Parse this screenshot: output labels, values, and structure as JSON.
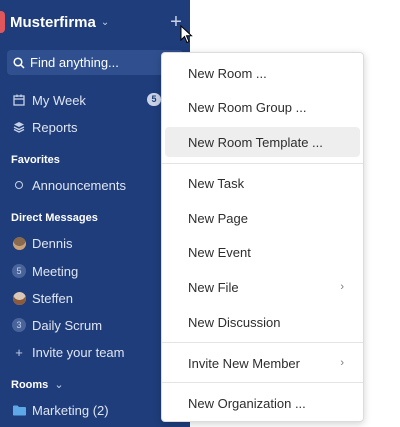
{
  "workspace": {
    "name": "Musterfirma"
  },
  "search": {
    "placeholder": "Find anything..."
  },
  "nav": {
    "my_week": {
      "label": "My Week",
      "badge": "5"
    },
    "reports": {
      "label": "Reports"
    }
  },
  "favorites": {
    "title": "Favorites",
    "items": [
      {
        "label": "Announcements"
      }
    ]
  },
  "direct_messages": {
    "title": "Direct Messages",
    "items": [
      {
        "label": "Dennis",
        "avatar": ""
      },
      {
        "label": "Meeting",
        "avatar": "5"
      },
      {
        "label": "Steffen",
        "avatar": ""
      },
      {
        "label": "Daily Scrum",
        "avatar": "3"
      }
    ],
    "invite_label": "Invite your team"
  },
  "rooms": {
    "title": "Rooms",
    "items": [
      {
        "label": "Marketing (2)"
      }
    ]
  },
  "menu": {
    "items": [
      {
        "label": "New Room ..."
      },
      {
        "label": "New Room Group ..."
      },
      {
        "label": "New Room Template ..."
      },
      {
        "label": "New Task"
      },
      {
        "label": "New Page"
      },
      {
        "label": "New Event"
      },
      {
        "label": "New File"
      },
      {
        "label": "New Discussion"
      },
      {
        "label": "Invite New Member"
      },
      {
        "label": "New Organization ..."
      }
    ]
  },
  "colors": {
    "sidebar": "#1f3d7a",
    "accent": "#e0565b",
    "highlight": "#eeeeee"
  }
}
